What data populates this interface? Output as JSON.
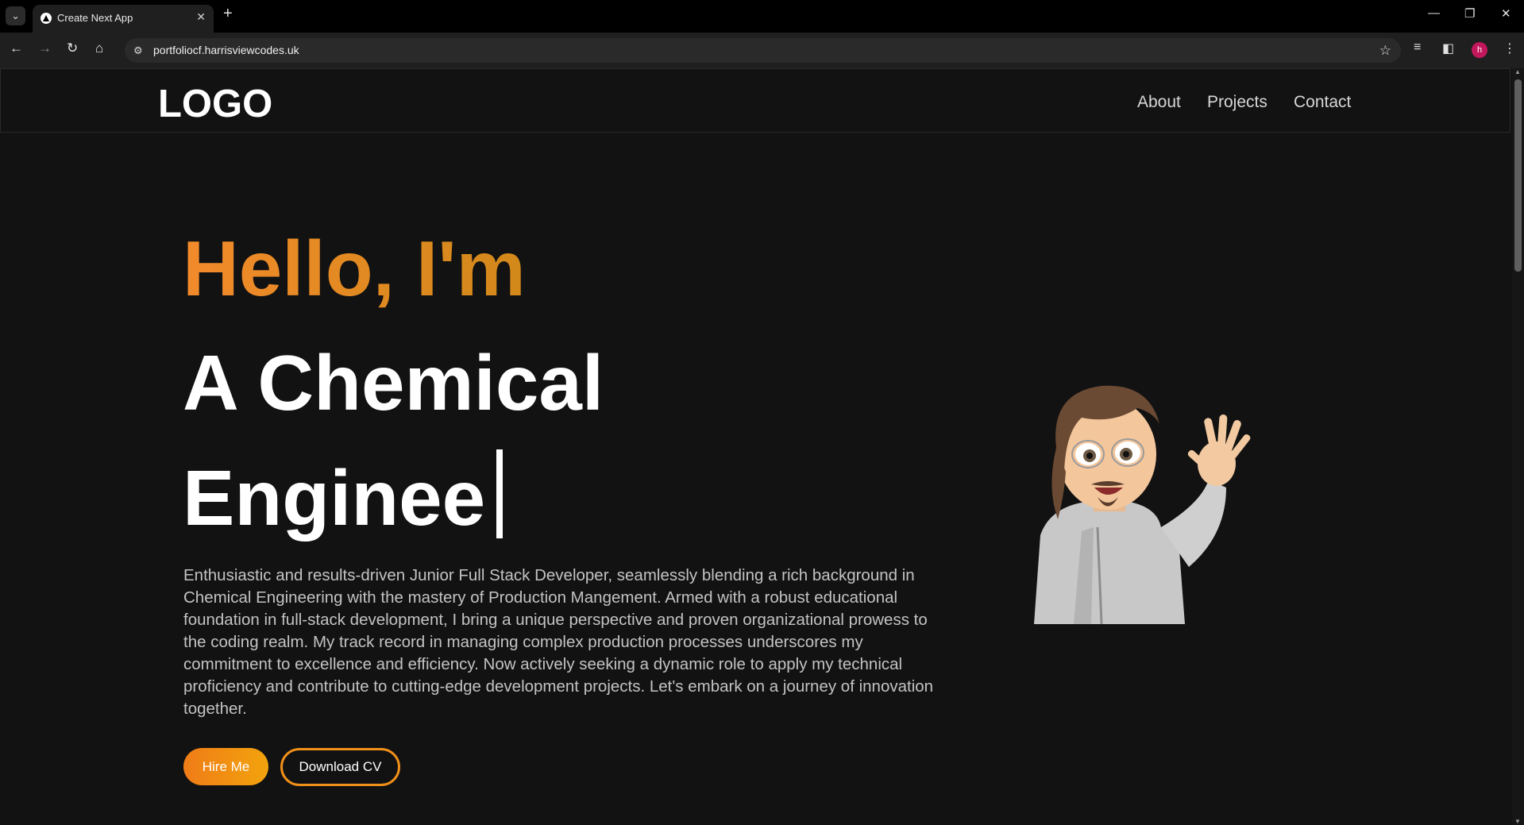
{
  "browser": {
    "tab_search_icon": "chevron-down-icon",
    "tab": {
      "title": "Create Next App",
      "favicon": "vercel-triangle-icon",
      "close": "✕"
    },
    "new_tab": "+",
    "window_controls": {
      "minimize": "—",
      "restore": "❐",
      "close": "✕"
    },
    "nav": {
      "back": "←",
      "forward": "→",
      "reload": "↻",
      "home": "⌂"
    },
    "url": "portfoliocf.harrisviewcodes.uk",
    "site_info_icon": "tune-icon",
    "bookmark_star": "☆",
    "toolbar_icons": {
      "reading_list": "≡",
      "side_panel": "◧"
    },
    "profile_initial": "h",
    "menu": "⋮"
  },
  "site": {
    "logo": "LOGO",
    "nav": [
      "About",
      "Projects",
      "Contact"
    ],
    "hero": {
      "greeting": "Hello, I'm",
      "title_line1": "A Chemical",
      "title_line2": "Enginee",
      "bio": "Enthusiastic and results-driven Junior Full Stack Developer, seamlessly blending a rich background in Chemical Engineering with the mastery of Production Mangement. Armed with a robust educational foundation in full-stack development, I bring a unique perspective and proven organizational prowess to the coding realm. My track record in managing complex production processes underscores my commitment to excellence and efficiency. Now actively seeking a dynamic role to apply my technical proficiency and contribute to cutting-edge development projects. Let's embark on a journey of innovation together.",
      "hire_button": "Hire Me",
      "cv_button": "Download CV",
      "avatar_icon": "memoji-waving-icon"
    }
  },
  "colors": {
    "accent_orange": "#f28a2b",
    "page_bg": "#121212"
  }
}
